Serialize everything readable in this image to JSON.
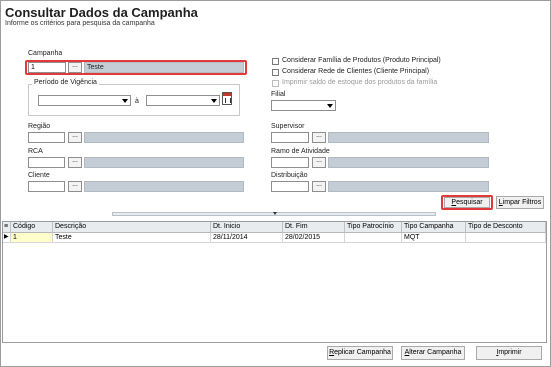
{
  "header": {
    "title": "Consultar Dados da Campanha",
    "subtitle": "Informe os critérios para pesquisa da campanha"
  },
  "campanha": {
    "label": "Campanha",
    "code_value": "1",
    "name_value": "Teste",
    "lookup_label": "..."
  },
  "periodo": {
    "label": "Período de Vigência",
    "separator": "à",
    "start_value": "",
    "end_value": ""
  },
  "filters_left": {
    "regiao": {
      "label": "Região",
      "lookup_label": "..."
    },
    "rca": {
      "label": "RCA",
      "lookup_label": "..."
    },
    "cliente": {
      "label": "Cliente",
      "lookup_label": "..."
    }
  },
  "options": {
    "familia": "Considerar Família de Produtos (Produto Principal)",
    "rede": "Considerar Rede de Clientes (Cliente Principal)",
    "saldo": "Imprimir saldo de estoque dos produtos da família"
  },
  "filters_right": {
    "filial": {
      "label": "Filial",
      "value": ""
    },
    "supervisor": {
      "label": "Supervisor",
      "lookup_label": "..."
    },
    "ramo": {
      "label": "Ramo de Atividade",
      "lookup_label": "..."
    },
    "distribuicao": {
      "label": "Distribuição",
      "lookup_label": "..."
    }
  },
  "actions": {
    "pesquisar_prefix": "",
    "pesquisar_underline": "P",
    "pesquisar_rest": "esquisar",
    "limpar_prefix": "",
    "limpar_underline": "L",
    "limpar_rest": "impar Filtros"
  },
  "grid": {
    "columns": [
      "Código",
      "Descrição",
      "Dt. Inicio",
      "Dt. Fim",
      "Tipo Patrocínio",
      "Tipo Campanha",
      "Tipo de Desconto"
    ],
    "rows": [
      {
        "codigo": "1",
        "descricao": "Teste",
        "dt_inicio": "28/11/2014",
        "dt_fim": "28/02/2015",
        "tipo_patrocinio": "",
        "tipo_campanha": "MQT",
        "tipo_desconto": ""
      }
    ]
  },
  "footer": {
    "replicar_prefix": "",
    "replicar_underline": "R",
    "replicar_rest": "eplicar Campanha",
    "alterar_prefix": "",
    "alterar_underline": "A",
    "alterar_rest": "lterar Campanha",
    "imprimir_prefix": "",
    "imprimir_underline": "I",
    "imprimir_rest": "mprimir"
  },
  "colors": {
    "highlight": "#e23a3a",
    "readonly_fill": "#c4cdd5",
    "selected_cell": "#ffffcc"
  }
}
